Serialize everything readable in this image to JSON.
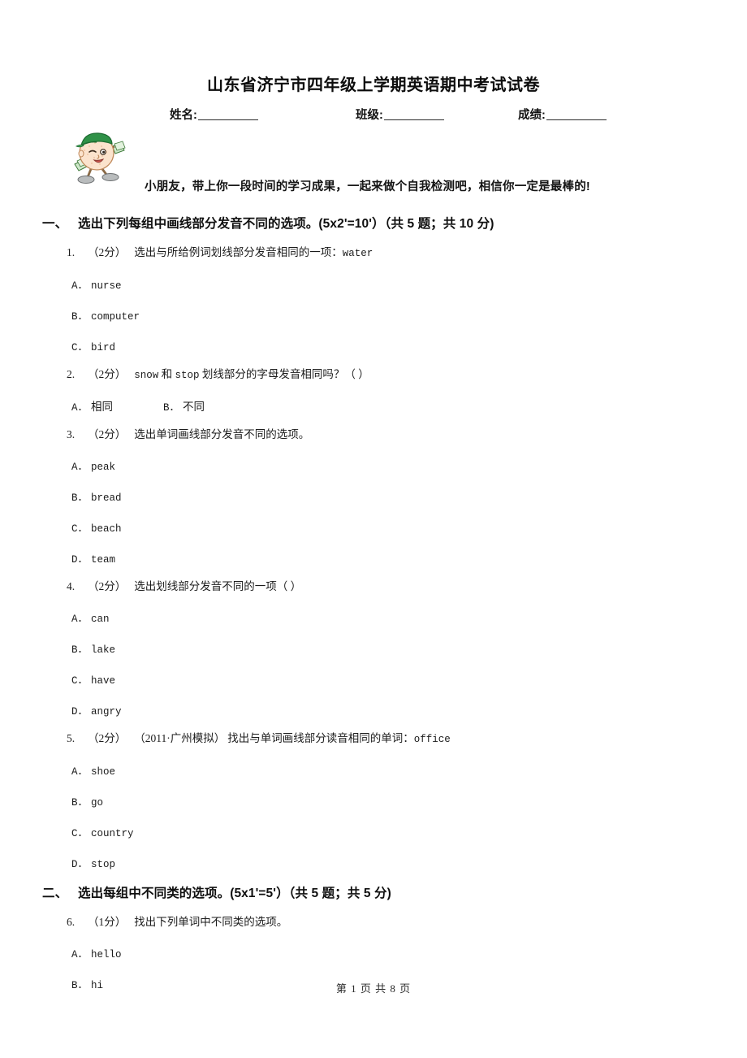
{
  "document": {
    "title": "山东省济宁市四年级上学期英语期中考试试卷",
    "greeting": "小朋友，带上你一段时间的学习成果，一起来做个自我检测吧，相信你一定是最棒的!",
    "mascot_icon": "cartoon-boy-with-money-icon",
    "footer": "第 1 页 共 8 页"
  },
  "id_fields": [
    {
      "label": "姓名:"
    },
    {
      "label": "班级:"
    },
    {
      "label": "成绩:"
    }
  ],
  "sections": [
    {
      "number": "一、",
      "heading": "选出下列每组中画线部分发音不同的选项。(5x2'=10'）（共 5 题；共 10 分)",
      "questions": [
        {
          "num": "1.",
          "points": "（2分）",
          "stem": "选出与所给例词划线部分发音相同的一项：",
          "stem_en": "water",
          "layout": "stacked",
          "options": [
            {
              "key": "A．",
              "value": "nurse",
              "cjk": false
            },
            {
              "key": "B．",
              "value": "computer",
              "cjk": false
            },
            {
              "key": "C．",
              "value": "bird",
              "cjk": false
            }
          ]
        },
        {
          "num": "2.",
          "points": "（2分）",
          "stem_en": "snow",
          "stem_mid": "和",
          "stem_en2": "stop",
          "stem": "划线部分的字母发音相同吗？（      ）",
          "layout": "inline",
          "options": [
            {
              "key": "A．",
              "value": "相同",
              "cjk": true
            },
            {
              "key": "B．",
              "value": "不同",
              "cjk": true
            }
          ]
        },
        {
          "num": "3.",
          "points": "（2分）",
          "stem": "选出单词画线部分发音不同的选项。",
          "layout": "stacked",
          "options": [
            {
              "key": "A．",
              "value": "peak",
              "cjk": false
            },
            {
              "key": "B．",
              "value": "bread",
              "cjk": false
            },
            {
              "key": "C．",
              "value": "beach",
              "cjk": false
            },
            {
              "key": "D．",
              "value": "team",
              "cjk": false
            }
          ]
        },
        {
          "num": "4.",
          "points": "（2分）",
          "stem": "选出划线部分发音不同的一项（      ）",
          "layout": "stacked",
          "options": [
            {
              "key": "A．",
              "value": "can",
              "cjk": false
            },
            {
              "key": "B．",
              "value": "lake",
              "cjk": false
            },
            {
              "key": "C．",
              "value": "have",
              "cjk": false
            },
            {
              "key": "D．",
              "value": "angry",
              "cjk": false
            }
          ]
        },
        {
          "num": "5.",
          "points": "（2分）",
          "source": "（2011·广州模拟）",
          "stem": "找出与单词画线部分读音相同的单词：",
          "stem_en": "office",
          "layout": "stacked",
          "options": [
            {
              "key": "A．",
              "value": "shoe",
              "cjk": false
            },
            {
              "key": "B．",
              "value": "go",
              "cjk": false
            },
            {
              "key": "C．",
              "value": "country",
              "cjk": false
            },
            {
              "key": "D．",
              "value": "stop",
              "cjk": false
            }
          ]
        }
      ]
    },
    {
      "number": "二、",
      "heading": "选出每组中不同类的选项。(5x1'=5'）（共 5 题；共 5 分)",
      "questions": [
        {
          "num": "6.",
          "points": "（1分）",
          "stem": "找出下列单词中不同类的选项。",
          "layout": "stacked",
          "options": [
            {
              "key": "A．",
              "value": "hello",
              "cjk": false
            },
            {
              "key": "B．",
              "value": "hi",
              "cjk": false
            }
          ]
        }
      ]
    }
  ]
}
